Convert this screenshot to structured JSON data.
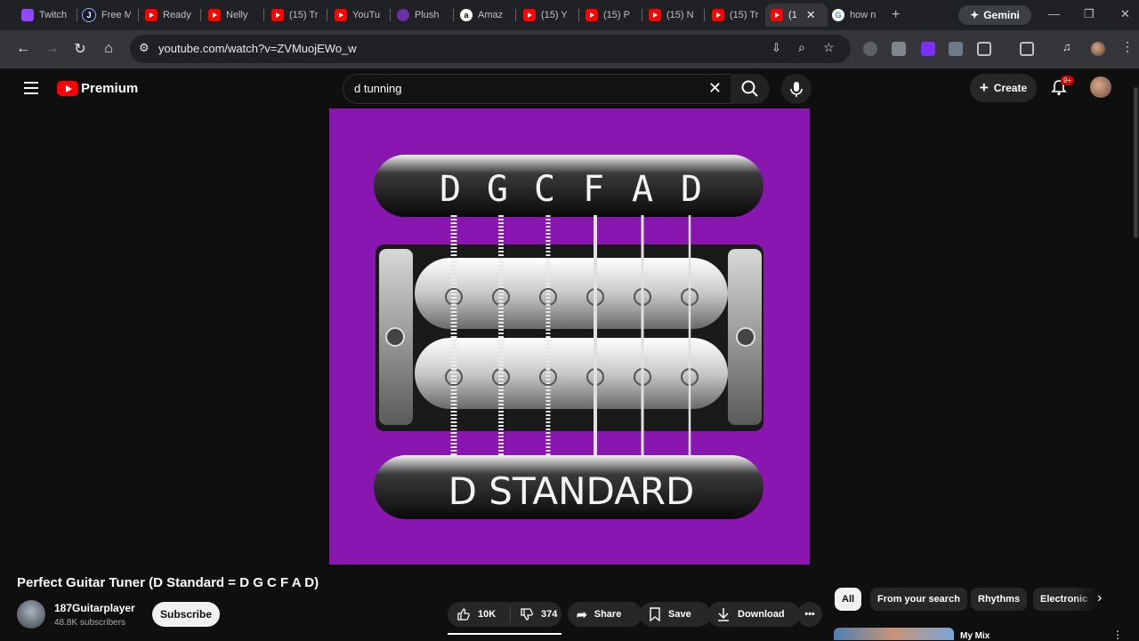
{
  "browser": {
    "tabs": [
      {
        "title": "Twitch",
        "icon": "twitch-icon"
      },
      {
        "title": "Free M",
        "icon": "j-icon"
      },
      {
        "title": "Ready",
        "icon": "youtube-icon"
      },
      {
        "title": "Nelly",
        "icon": "youtube-icon"
      },
      {
        "title": "(15) Tr",
        "icon": "youtube-icon"
      },
      {
        "title": "YouTu",
        "icon": "youtube-icon"
      },
      {
        "title": "Plush",
        "icon": "plush-icon"
      },
      {
        "title": "Amaz",
        "icon": "amazon-icon"
      },
      {
        "title": "(15) Y",
        "icon": "youtube-icon"
      },
      {
        "title": "(15) P",
        "icon": "youtube-icon"
      },
      {
        "title": "(15) N",
        "icon": "youtube-icon"
      },
      {
        "title": "(15) Tr",
        "icon": "youtube-icon"
      },
      {
        "title": "(1",
        "icon": "youtube-icon"
      },
      {
        "title": "how n",
        "icon": "google-icon"
      }
    ],
    "gemini_label": "Gemini",
    "url": "youtube.com/watch?v=ZVMuojEWo_w"
  },
  "youtube": {
    "logo_text": "Premium",
    "search_query": "d tunning",
    "create_label": "Create",
    "notification_badge": "9+",
    "video": {
      "thumbnail_tuning": [
        "D",
        "G",
        "C",
        "F",
        "A",
        "D"
      ],
      "thumbnail_caption": "D STANDARD",
      "title": "Perfect Guitar Tuner (D Standard = D G C F A D)",
      "channel": "187Guitarplayer",
      "subscribers": "48.8K subscribers",
      "subscribe_label": "Subscribe",
      "likes": "10K",
      "dislikes": "374",
      "share_label": "Share",
      "save_label": "Save",
      "download_label": "Download"
    },
    "chips": [
      "All",
      "From your search",
      "Rhythms",
      "Electronic"
    ],
    "next_item_title": "My Mix"
  },
  "colors": {
    "yt_red": "#ff0000",
    "thumb_purple": "#8a16b0",
    "background": "#0f0f0f"
  }
}
